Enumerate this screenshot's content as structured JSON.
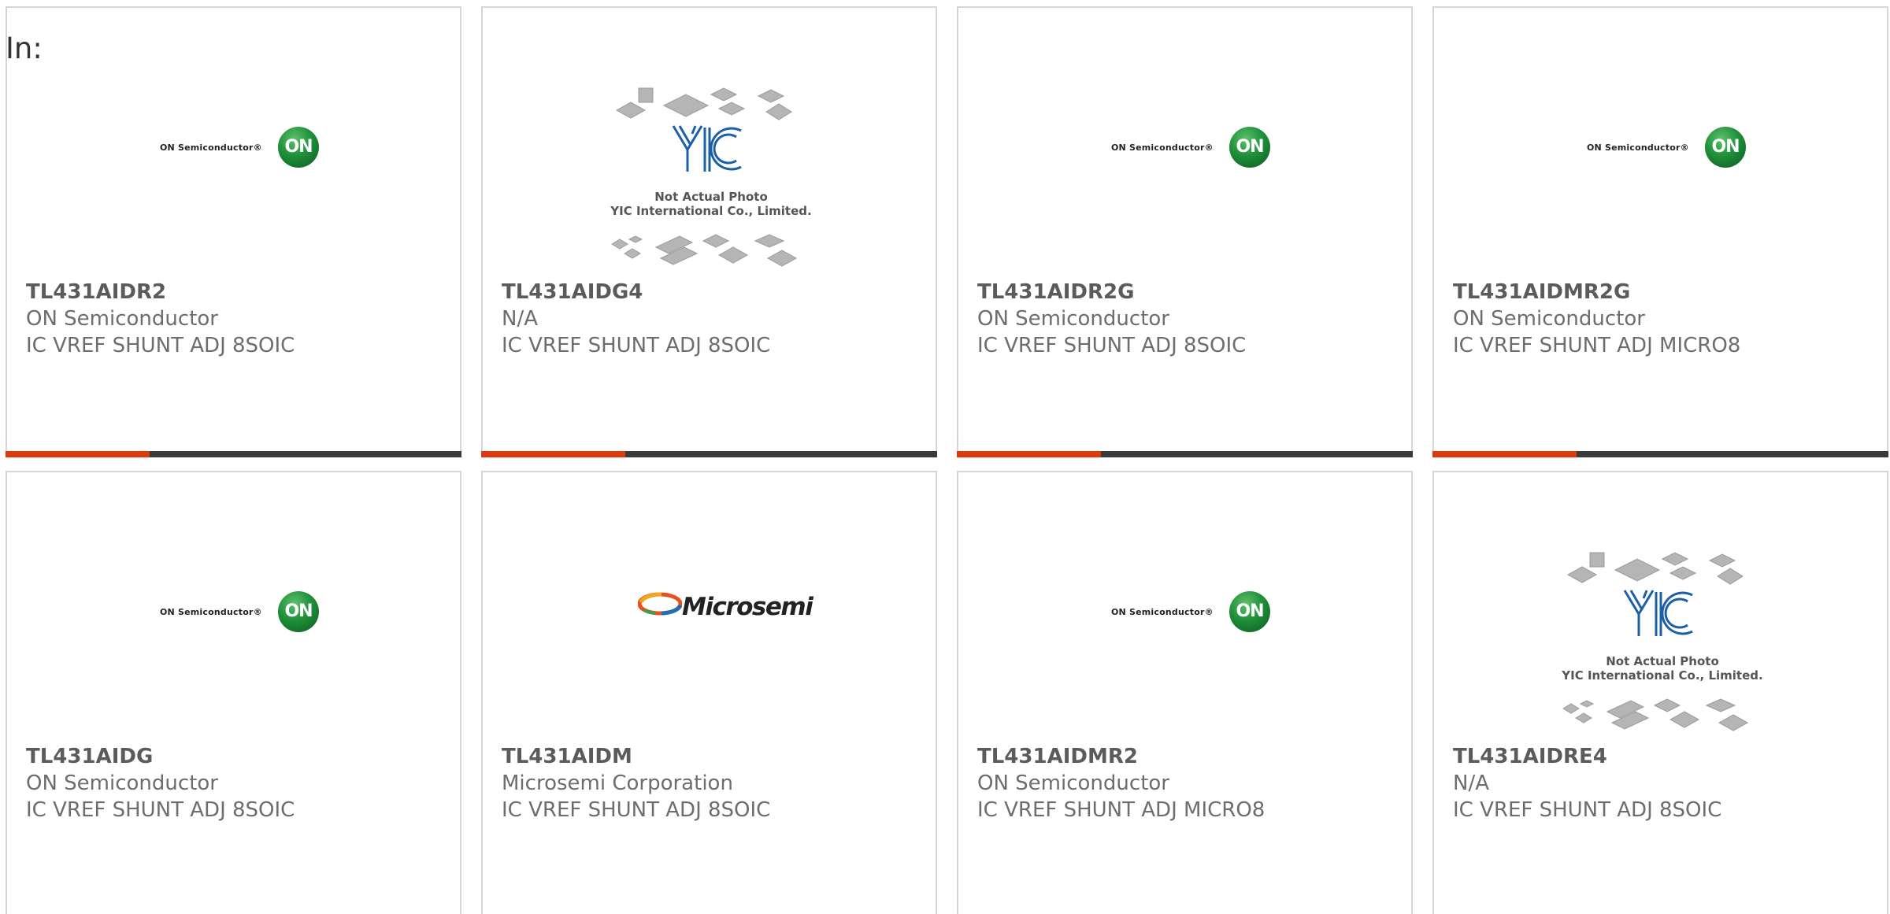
{
  "search": {
    "label": "In:"
  },
  "colors": {
    "accent": "#e03a0c",
    "bar_dark": "#3a3a3a",
    "card_border": "#d6d6d6",
    "on_green": "#1f8f39"
  },
  "logos": {
    "on": {
      "text": "ON Semiconductor®",
      "mark": "ON"
    },
    "microsemi": {
      "text": "Microsemi"
    },
    "yic": {
      "line1": "Not Actual Photo",
      "line2": "YIC International Co., Limited."
    }
  },
  "cards": [
    {
      "part_number": "TL431AIDR2",
      "manufacturer": "ON Semiconductor",
      "description": "IC VREF SHUNT ADJ 8SOIC",
      "logo": "on-semiconductor-logo"
    },
    {
      "part_number": "TL431AIDG4",
      "manufacturer": "N/A",
      "description": "IC VREF SHUNT ADJ 8SOIC",
      "logo": "yic-placeholder-logo"
    },
    {
      "part_number": "TL431AIDR2G",
      "manufacturer": "ON Semiconductor",
      "description": "IC VREF SHUNT ADJ 8SOIC",
      "logo": "on-semiconductor-logo"
    },
    {
      "part_number": "TL431AIDMR2G",
      "manufacturer": "ON Semiconductor",
      "description": "IC VREF SHUNT ADJ MICRO8",
      "logo": "on-semiconductor-logo"
    },
    {
      "part_number": "TL431AIDG",
      "manufacturer": "ON Semiconductor",
      "description": "IC VREF SHUNT ADJ 8SOIC",
      "logo": "on-semiconductor-logo"
    },
    {
      "part_number": "TL431AIDM",
      "manufacturer": "Microsemi Corporation",
      "description": "IC VREF SHUNT ADJ 8SOIC",
      "logo": "microsemi-logo"
    },
    {
      "part_number": "TL431AIDMR2",
      "manufacturer": "ON Semiconductor",
      "description": "IC VREF SHUNT ADJ MICRO8",
      "logo": "on-semiconductor-logo"
    },
    {
      "part_number": "TL431AIDRE4",
      "manufacturer": "N/A",
      "description": "IC VREF SHUNT ADJ 8SOIC",
      "logo": "yic-placeholder-logo"
    }
  ]
}
